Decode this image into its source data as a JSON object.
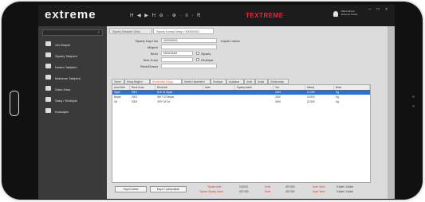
{
  "app": {
    "logo": "extreme",
    "brand": "TEXTREME",
    "toolbar_icons": "H ◀ ▶ H ⊖ · ⊕ · ≡ · R",
    "user_name_line1": "Marco Rossi",
    "user_name_line2": "Extreme Textile",
    "window_controls": "– □ ×"
  },
  "sidebar": {
    "items": [
      {
        "label": "Veri Başlık"
      },
      {
        "label": "Sipariş Takipleri"
      },
      {
        "label": "Üretim Takipleri"
      },
      {
        "label": "Malzeme Takipleri"
      },
      {
        "label": "Satın Alma"
      },
      {
        "label": "Satış / Sevkiyat"
      },
      {
        "label": "Kumaşlar"
      }
    ]
  },
  "tabs": [
    {
      "label": "Sipariş Detayları Girişi"
    },
    {
      "label": "Sipariş Kumaş Detayı / 000000002"
    }
  ],
  "form": {
    "order_no_label": "Sipariş Kayıt No",
    "order_no_value": "000000002",
    "related_label": "Kayıtlı Listesi",
    "customer_label": "Müşteri",
    "unit_label": "Birim",
    "unit_value": "Metre/Adet",
    "stock_label": "Stok Kodu",
    "stock_value": "",
    "desc_label": "Renk/Desen",
    "desc_value": "",
    "check_1": "Sipariş",
    "check_2": "Sevkiyat",
    "note_label": "Ebatlar",
    "note_value": "Desenli Kumaşlar / Çalışmaları"
  },
  "subtabs": [
    {
      "label": "Genel"
    },
    {
      "label": "Detay Bilgileri"
    },
    {
      "label": "Renk/Kalite Detayı"
    },
    {
      "label": "Üretim Hareketleri"
    },
    {
      "label": "Sevkiyat"
    },
    {
      "label": "Açıklama"
    },
    {
      "label": "Ünite"
    },
    {
      "label": "Notlar"
    },
    {
      "label": "Dökümanlar"
    }
  ],
  "grid": {
    "headers": [
      "Ana Renk",
      "Renk Kodu",
      "Renk Adı",
      "Adet",
      "Sipariş Adedi",
      "Ton",
      "Metraj",
      "Birim"
    ],
    "rows": [
      [
        "Siyah",
        "0001",
        "BLK 01 Siyah",
        "",
        "",
        "1000",
        "11.200",
        "Kg"
      ],
      [
        "Beyaz",
        "0002",
        "WHT 02 Beyaz",
        "",
        "",
        "2000",
        "14.500",
        "Kg"
      ],
      [
        "Gri",
        "0003",
        "GRY 03 Gri",
        "",
        "",
        "4000",
        "21.500",
        "Kg"
      ]
    ]
  },
  "footer": {
    "btn_list": "Kayıt Listesi",
    "btn_close": "Kayıt / Çalışmaları",
    "total_label_1": "Toplam Adet",
    "total_value_1": "101023",
    "total_label_2": "Ünite",
    "total_value_2": "407.000",
    "total_label_3": "Sevk Tarihi",
    "total_value_3": "0 Adet / 0 Adet",
    "sub_label_1": "Toplam Sipariş Adedi",
    "sub_value_1": "407.000",
    "sub_label_2": "Ünite",
    "sub_value_2": "407.000",
    "sub_label_3": "Kayıt Tarihi",
    "sub_value_3": "0 Adet / 0 Adet"
  }
}
